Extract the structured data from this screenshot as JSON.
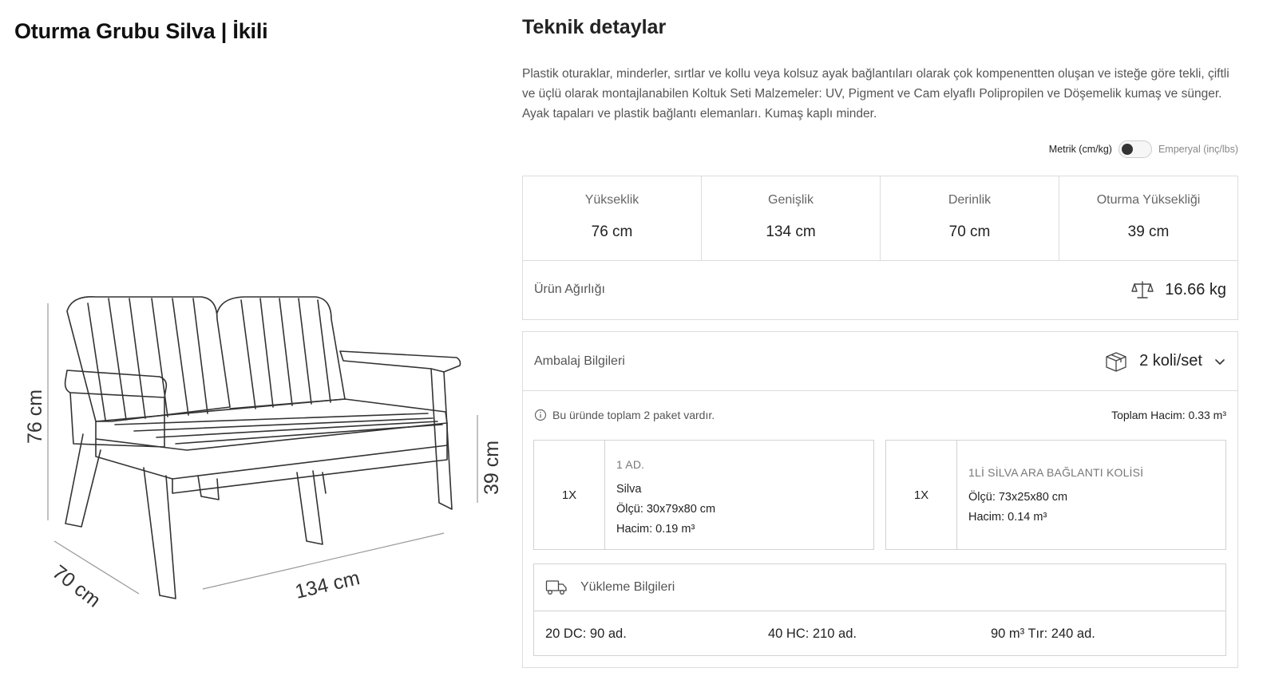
{
  "product": {
    "title": "Oturma Grubu Silva | İkili"
  },
  "drawing": {
    "height_label": "76 cm",
    "seat_height_label": "39 cm",
    "depth_label": "70 cm",
    "width_label": "134 cm"
  },
  "details": {
    "title": "Teknik detaylar",
    "description": "Plastik oturaklar, minderler, sırtlar ve kollu veya kolsuz ayak bağlantıları olarak çok kompenentten oluşan ve isteğe göre tekli, çiftli ve üçlü olarak montajlanabilen Koltuk Seti Malzemeler: UV, Pigment ve Cam elyaflı Polipropilen ve Döşemelik kumaş ve sünger. Ayak tapaları ve plastik bağlantı elemanları. Kumaş kaplı minder.",
    "unit_metric": "Metrik (cm/kg)",
    "unit_imperial": "Emperyal (inç/lbs)",
    "dimensions": [
      {
        "label": "Yükseklik",
        "value": "76 cm"
      },
      {
        "label": "Genişlik",
        "value": "134 cm"
      },
      {
        "label": "Derinlik",
        "value": "70 cm"
      },
      {
        "label": "Oturma Yüksekliği",
        "value": "39 cm"
      }
    ],
    "weight": {
      "label": "Ürün Ağırlığı",
      "value": "16.66 kg",
      "icon": "scale-icon"
    }
  },
  "packaging": {
    "label": "Ambalaj Bilgileri",
    "count": "2 koli/set",
    "info_text": "Bu üründe toplam 2 paket vardır.",
    "total_volume": "Toplam Hacim: 0.33 m³",
    "boxes": [
      {
        "qty": "1X",
        "name": "1 AD.",
        "product": "Silva",
        "size": "Ölçü: 30x79x80 cm",
        "volume": "Hacim: 0.19 m³"
      },
      {
        "qty": "1X",
        "name": "1Lİ SİLVA ARA BAĞLANTI KOLİSİ",
        "size": "Ölçü: 73x25x80 cm",
        "volume": "Hacim: 0.14 m³"
      }
    ]
  },
  "loading": {
    "label": "Yükleme Bilgileri",
    "values": [
      "20 DC: 90 ad.",
      "40 HC: 210 ad.",
      "90 m³ Tır: 240 ad."
    ]
  }
}
